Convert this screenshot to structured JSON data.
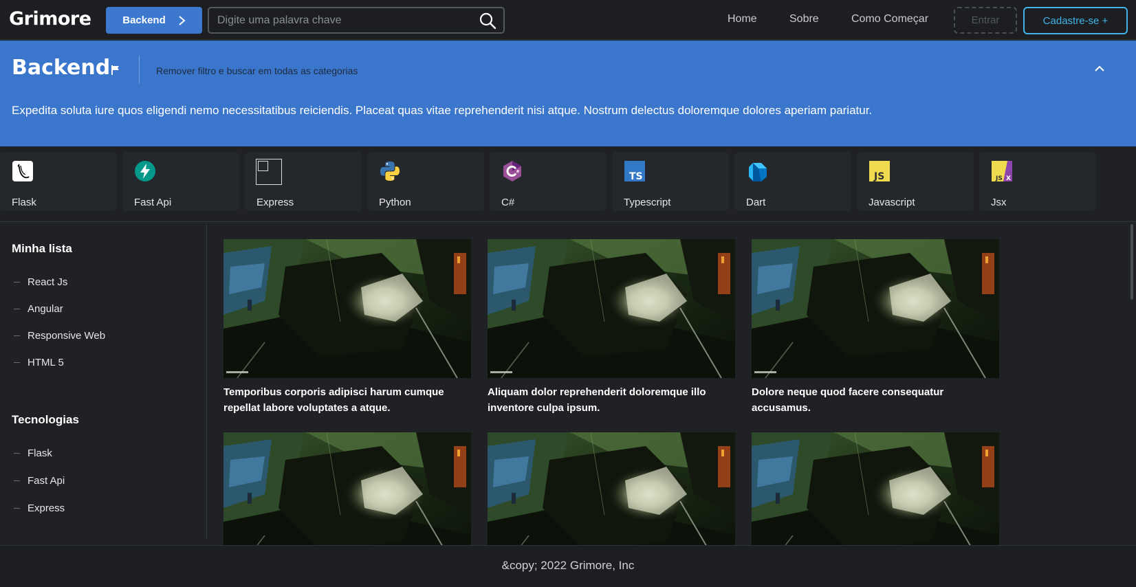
{
  "app": {
    "logo": "Grimore"
  },
  "header": {
    "category_button": "Backend",
    "search_placeholder": "Digite uma palavra chave",
    "nav": [
      "Home",
      "Sobre",
      "Como Começar"
    ],
    "login_label": "Entrar",
    "signup_label": "Cadastre-se +"
  },
  "banner": {
    "title": "Backend",
    "remove_filter": "Remover filtro e buscar em todas as categorias",
    "description": "Expedita soluta iure quos eligendi nemo necessitatibus reiciendis. Placeat quas vitae reprehenderit nisi atque. Nostrum delectus doloremque dolores aperiam pariatur."
  },
  "technologies": [
    {
      "label": "Flask",
      "icon": "flask-icon"
    },
    {
      "label": "Fast Api",
      "icon": "fastapi-icon"
    },
    {
      "label": "Express",
      "icon": "express-icon"
    },
    {
      "label": "Python",
      "icon": "python-icon"
    },
    {
      "label": "C#",
      "icon": "csharp-icon"
    },
    {
      "label": "Typescript",
      "icon": "typescript-icon"
    },
    {
      "label": "Dart",
      "icon": "dart-icon"
    },
    {
      "label": "Javascript",
      "icon": "javascript-icon"
    },
    {
      "label": "Jsx",
      "icon": "jsx-icon"
    }
  ],
  "sidebar": {
    "my_list_title": "Minha lista",
    "my_list": [
      "React Js",
      "Angular",
      "Responsive Web",
      "HTML 5"
    ],
    "tech_title": "Tecnologias",
    "tech_list": [
      "Flask",
      "Fast Api",
      "Express"
    ]
  },
  "posts": [
    {
      "title": "Temporibus corporis adipisci harum cumque repellat labore voluptates a atque."
    },
    {
      "title": "Aliquam dolor reprehenderit doloremque illo inventore culpa ipsum."
    },
    {
      "title": "Dolore neque quod facere consequatur accusamus."
    },
    {
      "title": ""
    },
    {
      "title": ""
    },
    {
      "title": ""
    }
  ],
  "footer": {
    "copyright": "&copy; 2022 Grimore, Inc"
  }
}
